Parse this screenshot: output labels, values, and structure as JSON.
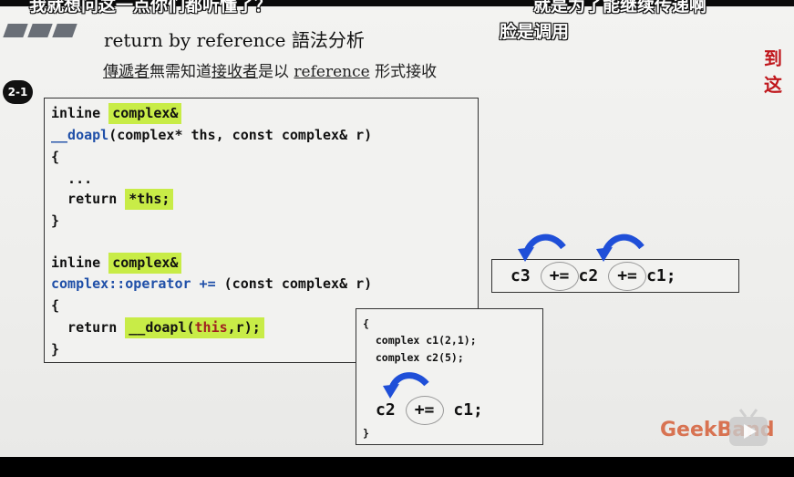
{
  "subtitles": {
    "top_left": "我就想问这一点你们都听懂了？",
    "top_right": "就是为了能继续传递啊",
    "right_line2": "脸是调用",
    "red_edge": "到这"
  },
  "slide": {
    "title": "return by reference 語法分析",
    "subtitle_parts": [
      "傳遞者",
      "無需知道",
      "接收者",
      "是以 ",
      "reference",
      " 形式接收"
    ],
    "badge": "2-1"
  },
  "main_code": {
    "l1_a": "inline ",
    "l1_b": "complex&",
    "l2_a": "__doapl",
    "l2_b": "(complex* ths, const complex& r)",
    "l3": "{",
    "l4": "  ...",
    "l5_a": "  return ",
    "l5_b": "*ths;",
    "l6": "}",
    "l7_a": "inline ",
    "l7_b": "complex&",
    "l8_a": "complex::operator +=",
    "l8_b": " (const complex& r)",
    "l9": "{",
    "l10_a": "  return ",
    "l10_b": "__doapl(",
    "l10_c": "this",
    "l10_d": ",r);",
    "l11": "}"
  },
  "example_code": {
    "l1": "{",
    "l2": "  complex c1(2,1);",
    "l3": "  complex c2(5);",
    "expr_left": "c2",
    "expr_op": "+=",
    "expr_right": "c1;",
    "l_end": "}"
  },
  "chain_expr": {
    "a": "c3",
    "op1": "+=",
    "b": "c2",
    "op2": "+=",
    "c": "c1;"
  },
  "watermark": {
    "brand": "GeekBand"
  },
  "colors": {
    "highlight": "#c8ec47",
    "keyword_blue": "#1f4fa8",
    "arrow_blue": "#1f4fd8",
    "brand_orange": "#d65f38"
  }
}
